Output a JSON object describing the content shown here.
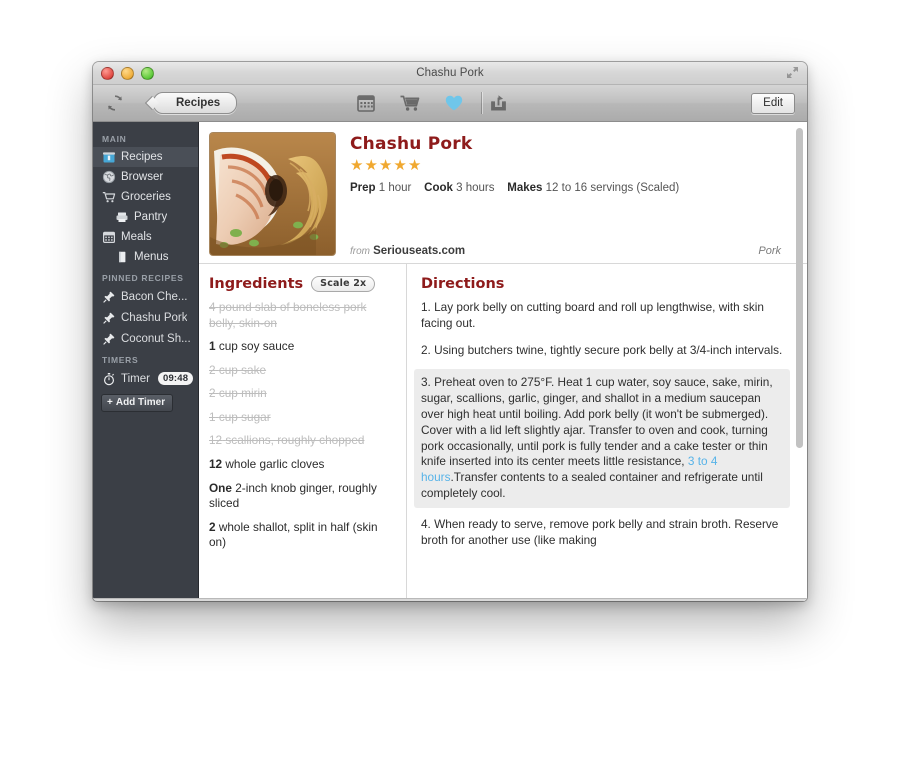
{
  "window": {
    "title": "Chashu Pork",
    "traffic_lights": [
      "close",
      "minimize",
      "zoom"
    ],
    "fullscreen_icon": "fullscreen-arrows-icon"
  },
  "toolbar": {
    "sync_icon": "sync-refresh-icon",
    "breadcrumb_label": "Recipes",
    "icons": [
      {
        "name": "calendar-icon",
        "label": "Calendar"
      },
      {
        "name": "shopping-cart-icon",
        "label": "Groceries"
      },
      {
        "name": "heart-icon",
        "label": "Favorite",
        "color": "#6fc6ea"
      }
    ],
    "share_icon": "share-icon",
    "edit_label": "Edit"
  },
  "sidebar": {
    "sections": [
      {
        "header": "MAIN",
        "items": [
          {
            "label": "Recipes",
            "icon": "recipe-box-icon",
            "selected": true,
            "indent": false
          },
          {
            "label": "Browser",
            "icon": "globe-icon",
            "selected": false,
            "indent": false
          },
          {
            "label": "Groceries",
            "icon": "shopping-cart-icon",
            "selected": false,
            "indent": false
          },
          {
            "label": "Pantry",
            "icon": "pantry-icon",
            "selected": false,
            "indent": true
          },
          {
            "label": "Meals",
            "icon": "calendar-icon",
            "selected": false,
            "indent": false
          },
          {
            "label": "Menus",
            "icon": "menu-book-icon",
            "selected": false,
            "indent": true
          }
        ]
      },
      {
        "header": "PINNED RECIPES",
        "items": [
          {
            "label": "Bacon Che...",
            "icon": "pin-icon"
          },
          {
            "label": "Chashu Pork",
            "icon": "pin-icon"
          },
          {
            "label": "Coconut Sh...",
            "icon": "pin-icon"
          }
        ]
      }
    ],
    "timers": {
      "header": "TIMERS",
      "icon": "stopwatch-icon",
      "label": "Timer",
      "value": "09:48",
      "add_label": "Add Timer",
      "add_icon": "plus-icon"
    }
  },
  "recipe": {
    "photo_alt": "chashu-pork-ramen-photo",
    "title": "Chashu Pork",
    "rating": 5,
    "rating_max": 5,
    "star_glyph": "★",
    "facts": [
      {
        "label": "Prep",
        "value": "1 hour"
      },
      {
        "label": "Cook",
        "value": "3 hours"
      },
      {
        "label": "Makes",
        "value": "12 to 16 servings (Scaled)"
      }
    ],
    "source_prefix": "from",
    "source": "Seriouseats.com",
    "category": "Pork"
  },
  "ingredients": {
    "title": "Ingredients",
    "scale_label": "Scale 2x",
    "items": [
      {
        "qty": "4",
        "text": "pound slab of boneless pork belly, skin-on",
        "done": true
      },
      {
        "qty": "1",
        "text": "cup soy sauce",
        "done": false
      },
      {
        "qty": "2",
        "text": "cup sake",
        "done": true
      },
      {
        "qty": "2",
        "text": "cup mirin",
        "done": true
      },
      {
        "qty": "1",
        "text": "cup sugar",
        "done": true
      },
      {
        "qty": "12",
        "text": "scallions, roughly chopped",
        "done": true
      },
      {
        "qty": "12",
        "text": "whole garlic cloves",
        "done": false
      },
      {
        "qty": "One",
        "text": "2-inch knob ginger, roughly sliced",
        "done": false
      },
      {
        "qty": "2",
        "text": "whole shallot, split in half (skin on)",
        "done": false
      }
    ]
  },
  "directions": {
    "title": "Directions",
    "steps": [
      {
        "number": "1.",
        "text": "Lay pork belly on cutting board and roll up lengthwise, with skin facing out.",
        "active": false
      },
      {
        "number": "2.",
        "text": "Using butchers twine, tightly secure pork belly at 3/4-inch intervals.",
        "active": false
      },
      {
        "number": "3.",
        "text_before": "Preheat oven to 275°F. Heat 1 cup water, soy sauce, sake, mirin, sugar, scallions, garlic, ginger, and shallot in a medium saucepan over high heat until boiling. Add pork belly (it won't be submerged). Cover with a lid left slightly ajar. Transfer to oven and cook, turning pork occasionally, until pork is fully tender and a cake tester or thin knife inserted into its center meets little resistance, ",
        "link": "3 to 4 hours",
        "text_after": ".Transfer contents to a sealed container and refrigerate until completely cool.",
        "active": true
      },
      {
        "number": "4.",
        "text": "When ready to serve, remove pork belly and strain broth. Reserve broth for another use (like making",
        "active": false
      }
    ]
  }
}
